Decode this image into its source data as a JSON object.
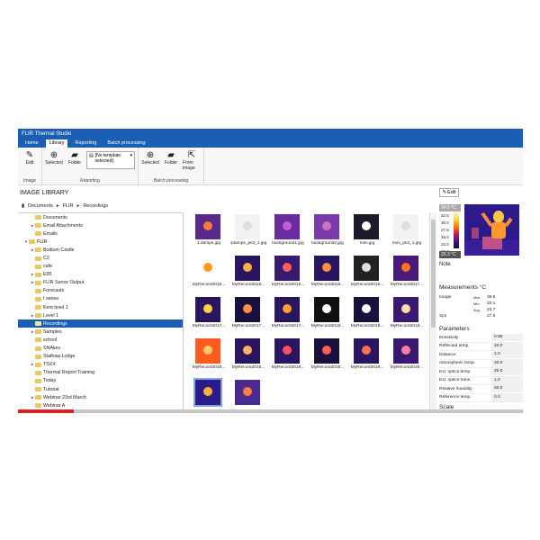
{
  "window_title": "FLIR Thermal Studio",
  "menu": [
    "Home",
    "Library",
    "Reporting",
    "Batch processing"
  ],
  "ribbon": {
    "image_group": {
      "label": "Image",
      "edit": "Edit"
    },
    "reporting_group": {
      "label": "Reporting",
      "selected": "Selected",
      "folder": "Folder",
      "template_placeholder": "[No template selected]"
    },
    "batch_group": {
      "label": "Batch processing",
      "selected": "Selected",
      "folder": "Folder",
      "from_image": "From image"
    }
  },
  "library_title": "IMAGE LIBRARY",
  "breadcrumb": [
    "Documents",
    "FLIR",
    "Recordings"
  ],
  "tree": [
    {
      "label": "Documents",
      "arrow": "",
      "indent": 1,
      "folder": true
    },
    {
      "label": "Email Attachments",
      "arrow": "▸",
      "indent": 1,
      "folder": true
    },
    {
      "label": "Emails",
      "arrow": "",
      "indent": 1,
      "folder": true
    },
    {
      "label": "FLIR",
      "arrow": "▾",
      "indent": 0,
      "folder": true
    },
    {
      "label": "Bodium Castle",
      "arrow": "▸",
      "indent": 1,
      "folder": true
    },
    {
      "label": "C2",
      "arrow": "",
      "indent": 1,
      "folder": true
    },
    {
      "label": "cafe",
      "arrow": "",
      "indent": 1,
      "folder": true
    },
    {
      "label": "E95",
      "arrow": "▸",
      "indent": 1,
      "folder": true
    },
    {
      "label": "FLIR Sense Output",
      "arrow": "▸",
      "indent": 1,
      "folder": true
    },
    {
      "label": "Forecasts",
      "arrow": "",
      "indent": 1,
      "folder": true
    },
    {
      "label": "I series",
      "arrow": "",
      "indent": 1,
      "folder": true
    },
    {
      "label": "Kent level 1",
      "arrow": "",
      "indent": 1,
      "folder": true
    },
    {
      "label": "Level 1",
      "arrow": "▸",
      "indent": 1,
      "folder": true
    },
    {
      "label": "Recordings",
      "arrow": "",
      "indent": 1,
      "folder": true,
      "selected": true
    },
    {
      "label": "Samples",
      "arrow": "▸",
      "indent": 1,
      "folder": true
    },
    {
      "label": "school",
      "arrow": "",
      "indent": 1,
      "folder": true
    },
    {
      "label": "SNAkes",
      "arrow": "",
      "indent": 1,
      "folder": true
    },
    {
      "label": "Stathaw Lodge",
      "arrow": "",
      "indent": 1,
      "folder": true
    },
    {
      "label": "TSXX",
      "arrow": "▸",
      "indent": 1,
      "folder": true
    },
    {
      "label": "Thermal Report Training",
      "arrow": "",
      "indent": 1,
      "folder": true
    },
    {
      "label": "Today",
      "arrow": "",
      "indent": 1,
      "folder": true
    },
    {
      "label": "Tutorial",
      "arrow": "",
      "indent": 1,
      "folder": true
    },
    {
      "label": "Webinar 23rd March",
      "arrow": "▸",
      "indent": 1,
      "folder": true
    },
    {
      "label": "Webinar A",
      "arrow": "",
      "indent": 1,
      "folder": true
    },
    {
      "label": "Webinar B",
      "arrow": "▸",
      "indent": 1,
      "folder": true
    }
  ],
  "thumbnails": [
    {
      "label": "1.damps.jpg",
      "bg": "#5a2a8a",
      "spot": "#ff7a3a"
    },
    {
      "label": "1damps_plot_1.jpg",
      "bg": "#f2f2f2",
      "spot": "#dddddd"
    },
    {
      "label": "background1.jpg",
      "bg": "#6a2aa0",
      "spot": "#c060d0"
    },
    {
      "label": "background2.jpg",
      "bg": "#7a3aaa",
      "spot": "#d070c0"
    },
    {
      "label": "mini.jpg",
      "bg": "#1a1a2a",
      "spot": "#ffffff"
    },
    {
      "label": "mini_plot_1.jpg",
      "bg": "#f2f2f2",
      "spot": "#dddddd"
    },
    {
      "label": "MyRecord2016...",
      "bg": "#ffffff",
      "spot": "#ff9a20"
    },
    {
      "label": "MyRecord2016...",
      "bg": "#2a1660",
      "spot": "#ffb040"
    },
    {
      "label": "MyRecord2016...",
      "bg": "#3a1a70",
      "spot": "#ff6060"
    },
    {
      "label": "MyRecord2016...",
      "bg": "#2a1660",
      "spot": "#ff9040"
    },
    {
      "label": "MyRecord2016...",
      "bg": "#222222",
      "spot": "#dddddd"
    },
    {
      "label": "MyRecord2017...",
      "bg": "#4a1a7a",
      "spot": "#ff7020"
    },
    {
      "label": "MyRecord2017...",
      "bg": "#2a1660",
      "spot": "#ffd040"
    },
    {
      "label": "MyRecord2017...",
      "bg": "#1a1040",
      "spot": "#ff9040"
    },
    {
      "label": "MyRecord2017...",
      "bg": "#2a1660",
      "spot": "#ffa030"
    },
    {
      "label": "MyRecord2018...",
      "bg": "#101010",
      "spot": "#ffffff"
    },
    {
      "label": "MyRecord2018...",
      "bg": "#1a1040",
      "spot": "#ffffff"
    },
    {
      "label": "MyRecord2018...",
      "bg": "#3a1a70",
      "spot": "#ffe0a0"
    },
    {
      "label": "MyRecord2018...",
      "bg": "#ff5a20",
      "spot": "#ffcc60"
    },
    {
      "label": "MyRecord2018...",
      "bg": "#2a1660",
      "spot": "#ffb060"
    },
    {
      "label": "MyRecord2018...",
      "bg": "#2a1660",
      "spot": "#ff5060"
    },
    {
      "label": "MyRecord2018...",
      "bg": "#1a1040",
      "spot": "#ff6050"
    },
    {
      "label": "MyRecord2018...",
      "bg": "#2a1660",
      "spot": "#ff7050"
    },
    {
      "label": "MyRecord2019...",
      "bg": "#3a1a70",
      "spot": "#ff80a0"
    },
    {
      "label": "",
      "bg": "#2d1a8a",
      "spot": "#ffb030",
      "selected": true
    },
    {
      "label": "",
      "bg": "#4a2a90",
      "spot": "#ff8040"
    }
  ],
  "right_panel": {
    "edit": "Edit",
    "scale_top": "34.5 °C",
    "scale_bottom": "20.3 °C",
    "scale_ticks": [
      "32.5",
      "30.0",
      "27.5",
      "25.0",
      "22.0",
      "20.0"
    ],
    "note": "Note",
    "measurements_title": "Measurements °C",
    "image_label": "Image",
    "max_label": "Max",
    "max_val": "35.5",
    "min_label": "Min",
    "min_val": "20.1",
    "avg_label": "Avg",
    "avg_val": "23.7",
    "sp1_label": "Sp1",
    "sp1_val": "27.6",
    "parameters_title": "Parameters",
    "parameters": [
      {
        "label": "Emissivity",
        "value": "0.95"
      },
      {
        "label": "Reflected temp.",
        "value": "20.0"
      },
      {
        "label": "Distance",
        "value": "1.0"
      },
      {
        "label": "Atmospheric temp.",
        "value": "20.0"
      },
      {
        "label": "Ext. optics temp.",
        "value": "20.0"
      },
      {
        "label": "Ext. optics trans.",
        "value": "1.0"
      },
      {
        "label": "Relative humidity",
        "value": "50.0"
      },
      {
        "label": "Reference temp.",
        "value": "0.0"
      }
    ],
    "scale_section": "Scale"
  },
  "video_progress": 0.11
}
